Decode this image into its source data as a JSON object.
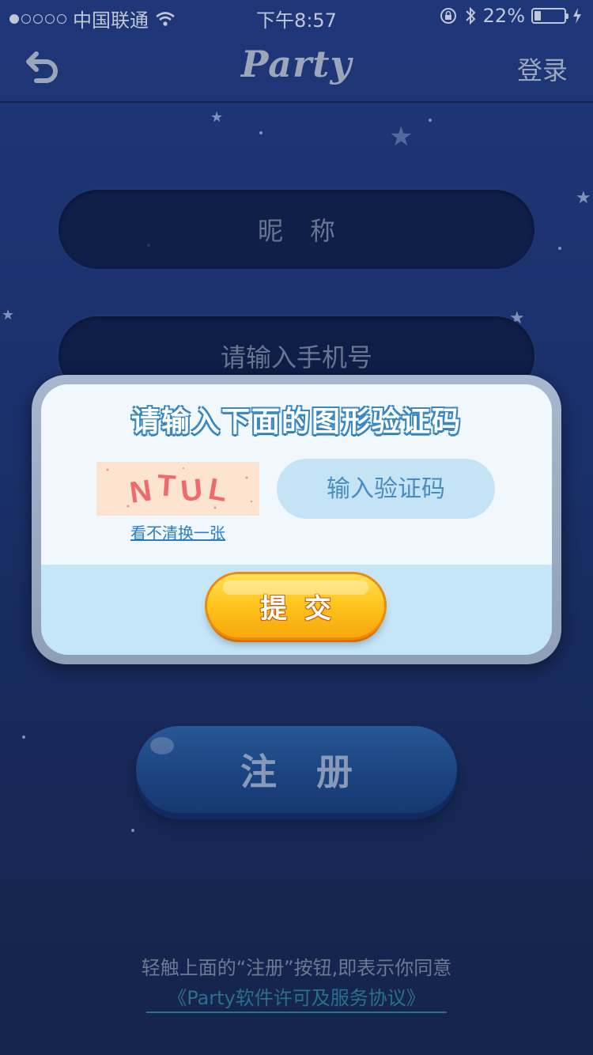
{
  "status_bar": {
    "carrier": "中国联通",
    "time": "下午8:57",
    "battery": "22%",
    "battery_level": 0.22
  },
  "nav": {
    "title": "Party",
    "login_label": "登录"
  },
  "form": {
    "nickname_placeholder": "昵称",
    "phone_placeholder": "请输入手机号",
    "register_label": "注册"
  },
  "dialog": {
    "title": "请输入下面的图形验证码",
    "captcha_text": "NTUL",
    "refresh_label": "看不清换一张",
    "code_placeholder": "输入验证码",
    "submit_label": "提交"
  },
  "agreement": {
    "text": "轻触上面的“注册”按钮,即表示你同意",
    "link": "《Party软件许可及服务协议》"
  }
}
